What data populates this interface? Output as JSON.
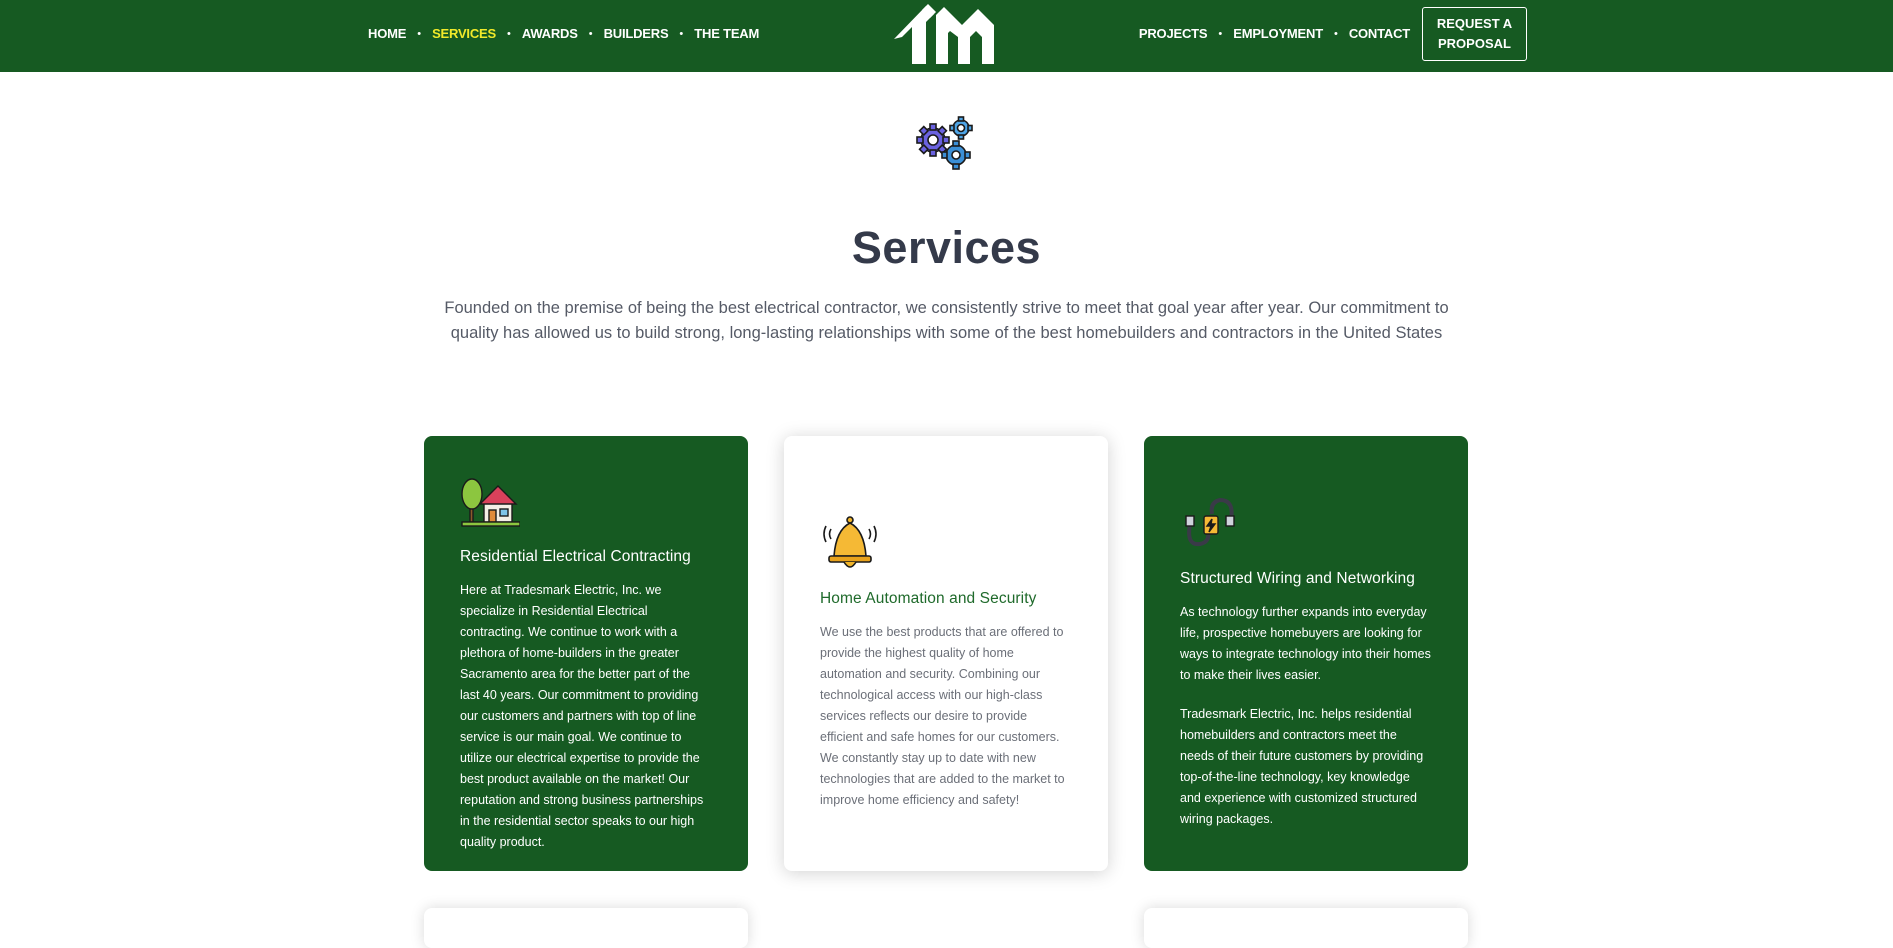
{
  "nav": {
    "left": [
      "HOME",
      "SERVICES",
      "AWARDS",
      "BUILDERS",
      "THE TEAM"
    ],
    "right": [
      "PROJECTS",
      "EMPLOYMENT",
      "CONTACT"
    ],
    "active": "SERVICES",
    "cta_line1": "REQUEST A",
    "cta_line2": "PROPOSAL"
  },
  "page": {
    "title": "Services",
    "intro": "Founded on the premise of being the best electrical contractor, we consistently strive to meet that goal year after year. Our commitment to quality has allowed us to build strong, long-lasting relationships with some of the best homebuilders and contractors in the United States"
  },
  "cards": [
    {
      "title": "Residential Electrical Contracting",
      "icon": "house-tree-icon",
      "paragraphs": [
        "Here at Tradesmark Electric, Inc. we specialize in Residential Electrical contracting. We continue to work with a plethora of home-builders in the greater Sacramento area for the better part of the last 40 years. Our commitment to providing our customers and partners with top of line service is our main goal. We continue to utilize our electrical expertise to provide the best product available on the market! Our reputation and strong business partnerships in the residential sector speaks to our high quality product."
      ]
    },
    {
      "title": "Home Automation and Security",
      "icon": "bell-icon",
      "paragraphs": [
        "We use the best products that are offered to provide the highest quality of home automation and security. Combining our technological access with our high-class services reflects our desire to provide efficient and safe homes for our customers. We constantly stay up to date with new technologies that are added to the market to improve home efficiency and safety!"
      ]
    },
    {
      "title": "Structured Wiring and Networking",
      "icon": "cable-plug-icon",
      "paragraphs": [
        "As technology further expands into everyday life, prospective homebuyers are looking for ways to integrate technology into their homes to make their lives easier.",
        "Tradesmark Electric, Inc. helps residential homebuilders and contractors meet the needs of their future customers by providing top-of-the-line technology, key knowledge and experience with customized structured wiring packages."
      ]
    }
  ],
  "colors": {
    "brand_green": "#165a22",
    "active_nav": "#f2ea2a",
    "title": "#343a4a"
  }
}
